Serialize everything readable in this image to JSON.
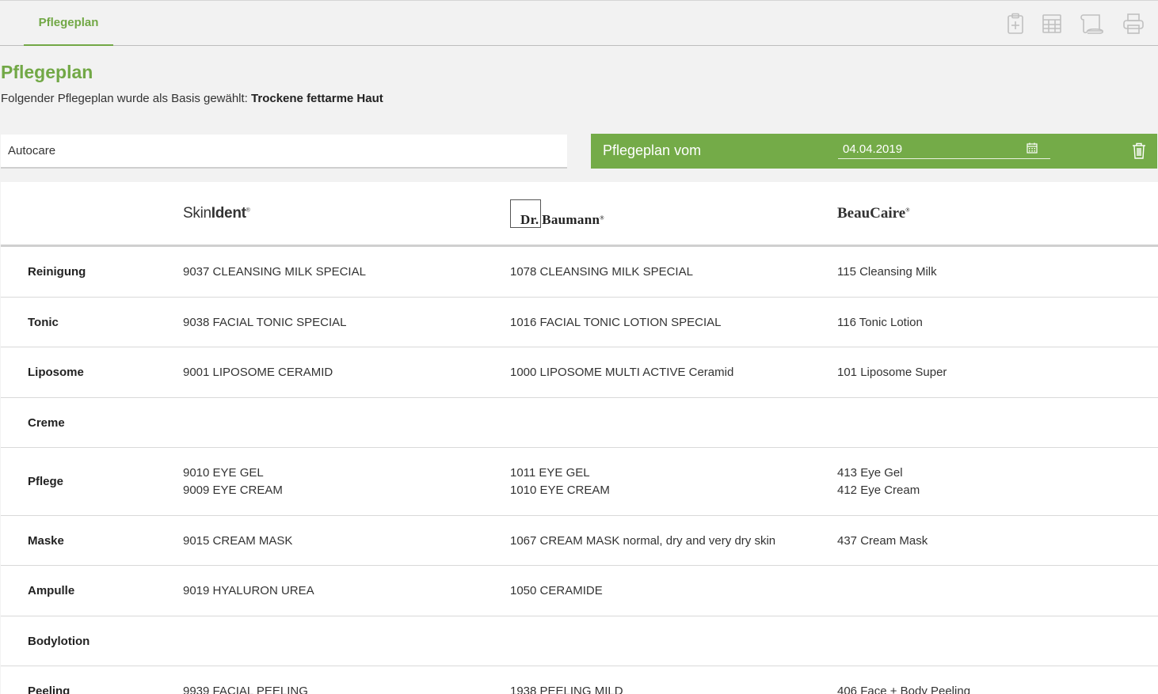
{
  "tab": {
    "label": "Pflegeplan"
  },
  "toolbar": {
    "icons": [
      "clipboard-plus-icon",
      "calendar-grid-icon",
      "scroll-icon",
      "printer-icon"
    ]
  },
  "page": {
    "title": "Pflegeplan",
    "basis_text": "Folgender Pflegeplan wurde als Basis gewählt:",
    "basis_value": "Trockene fettarme Haut"
  },
  "autocare": {
    "value": "Autocare"
  },
  "plan": {
    "label": "Pflegeplan vom",
    "date": "04.04.2019"
  },
  "brands": {
    "skinident": {
      "part1": "Skin",
      "part2": "Ident"
    },
    "baumann": {
      "dr": "Dr.",
      "name": "Baumann"
    },
    "beaucaire": {
      "name": "BeauCaire"
    }
  },
  "rows": [
    {
      "category": "Reinigung",
      "skinident": [
        "9037 CLEANSING MILK SPECIAL"
      ],
      "baumann": [
        "1078 CLEANSING MILK SPECIAL"
      ],
      "beaucaire": [
        "115 Cleansing Milk"
      ]
    },
    {
      "category": "Tonic",
      "skinident": [
        "9038 FACIAL TONIC SPECIAL"
      ],
      "baumann": [
        "1016 FACIAL TONIC LOTION SPECIAL"
      ],
      "beaucaire": [
        "116 Tonic Lotion"
      ]
    },
    {
      "category": "Liposome",
      "skinident": [
        "9001 LIPOSOME CERAMID"
      ],
      "baumann": [
        "1000 LIPOSOME MULTI ACTIVE Ceramid"
      ],
      "beaucaire": [
        "101 Liposome Super"
      ]
    },
    {
      "category": "Creme",
      "skinident": [],
      "baumann": [],
      "beaucaire": []
    },
    {
      "category": "Pflege",
      "skinident": [
        "9010 EYE GEL",
        "9009 EYE CREAM"
      ],
      "baumann": [
        "1011 EYE GEL",
        "1010 EYE CREAM"
      ],
      "beaucaire": [
        "413 Eye Gel",
        "412 Eye Cream"
      ]
    },
    {
      "category": "Maske",
      "skinident": [
        "9015 CREAM MASK"
      ],
      "baumann": [
        "1067 CREAM MASK normal, dry and very dry skin"
      ],
      "beaucaire": [
        "437 Cream Mask"
      ]
    },
    {
      "category": "Ampulle",
      "skinident": [
        "9019 HYALURON UREA"
      ],
      "baumann": [
        "1050 CERAMIDE"
      ],
      "beaucaire": []
    },
    {
      "category": "Bodylotion",
      "skinident": [],
      "baumann": [],
      "beaucaire": []
    },
    {
      "category": "Peeling",
      "skinident": [
        "9939 FACIAL PEELING"
      ],
      "baumann": [
        "1938 PEELING MILD"
      ],
      "beaucaire": [
        "406 Face + Body Peeling"
      ]
    }
  ]
}
